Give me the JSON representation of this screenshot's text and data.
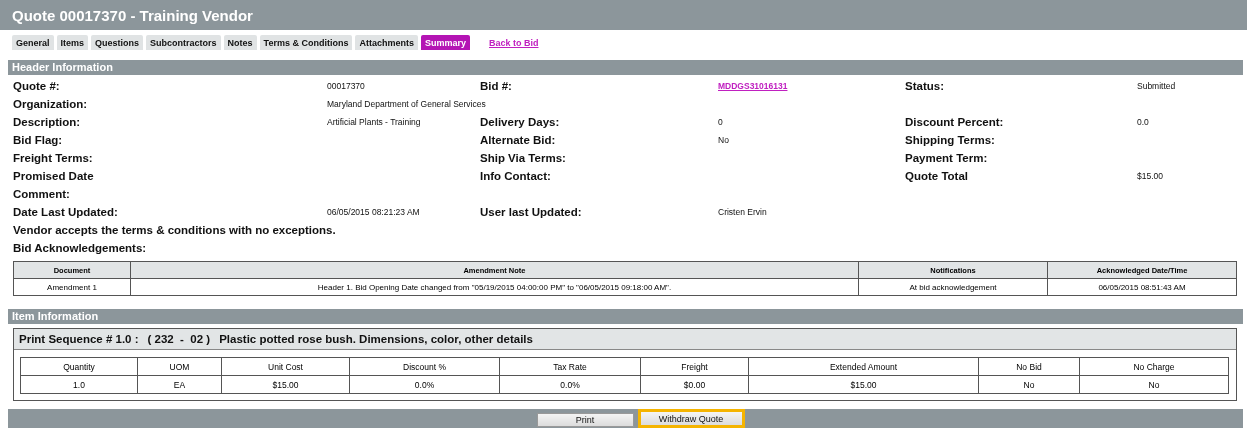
{
  "window": {
    "title": "Quote 00017370 - Training Vendor"
  },
  "tabs": [
    {
      "label": "General",
      "selected": false
    },
    {
      "label": "Items",
      "selected": false
    },
    {
      "label": "Questions",
      "selected": false
    },
    {
      "label": "Subcontractors",
      "selected": false
    },
    {
      "label": "Notes",
      "selected": false
    },
    {
      "label": "Terms & Conditions",
      "selected": false
    },
    {
      "label": "Attachments",
      "selected": false
    },
    {
      "label": "Summary",
      "selected": true
    }
  ],
  "back_link": "Back to Bid",
  "header_information": {
    "title": "Header Information",
    "rows": [
      {
        "kind": "fields",
        "fields": [
          {
            "kind": "text",
            "label": "Quote #:",
            "value": "00017370"
          },
          {
            "kind": "link",
            "label": "Bid #:",
            "value": "MDDGS31016131"
          },
          {
            "kind": "text",
            "label": "Status:",
            "value": "Submitted"
          }
        ]
      },
      {
        "kind": "fields",
        "fields": [
          {
            "kind": "text",
            "label": "Organization:",
            "value": "Maryland Department of General Services"
          }
        ]
      },
      {
        "kind": "fields",
        "fields": [
          {
            "kind": "text",
            "label": "Description:",
            "value": "Artificial Plants - Training"
          },
          {
            "kind": "text",
            "label": "Delivery Days:",
            "value": "0"
          },
          {
            "kind": "text",
            "label": "Discount Percent:",
            "value": "0.0"
          }
        ]
      },
      {
        "kind": "fields",
        "fields": [
          {
            "kind": "empty",
            "label": "Bid Flag:"
          },
          {
            "kind": "text",
            "label": "Alternate Bid:",
            "value": "No"
          },
          {
            "kind": "empty",
            "label": "Shipping Terms:"
          }
        ]
      },
      {
        "kind": "fields",
        "fields": [
          {
            "kind": "empty",
            "label": "Freight Terms:"
          },
          {
            "kind": "empty",
            "label": "Ship Via Terms:"
          },
          {
            "kind": "empty",
            "label": "Payment Term:"
          }
        ]
      },
      {
        "kind": "fields",
        "fields": [
          {
            "kind": "empty",
            "label": "Promised Date"
          },
          {
            "kind": "empty",
            "label": "Info Contact:"
          },
          {
            "kind": "text",
            "label": "Quote Total",
            "value": "$15.00"
          }
        ]
      },
      {
        "kind": "fields",
        "fields": [
          {
            "kind": "empty",
            "label": "Comment:"
          }
        ]
      },
      {
        "kind": "fields",
        "fields": [
          {
            "kind": "text",
            "label": "Date Last Updated:",
            "value": "06/05/2015 08:21:23 AM"
          },
          {
            "kind": "text",
            "label": "User last Updated:",
            "value": "Cristen Ervin"
          }
        ]
      },
      {
        "kind": "statement",
        "text": "Vendor accepts the terms & conditions with no exceptions."
      },
      {
        "kind": "statement",
        "text": "Bid Acknowledgements:"
      }
    ],
    "acknowledgements": {
      "columns": [
        "Document",
        "Amendment Note",
        "Notifications",
        "Acknowledged Date/Time"
      ],
      "rows": [
        [
          "Amendment 1",
          "Header 1. Bid Opening Date changed from \"05/19/2015 04:00:00 PM\" to \"06/05/2015 09:18:00 AM\".",
          "At bid acknowledgement",
          "06/05/2015 08:51:43 AM"
        ]
      ]
    }
  },
  "item_information": {
    "title": "Item Information",
    "items": [
      {
        "label": "Print Sequence # 1.0 :",
        "code": "( 232  -  02 )",
        "description": "Plastic potted rose bush. Dimensions, color, other details",
        "columns": [
          "Quantity",
          "UOM",
          "Unit Cost",
          "Discount %",
          "Tax Rate",
          "Freight",
          "Extended Amount",
          "No Bid",
          "No Charge"
        ],
        "rows": [
          [
            "1.0",
            "EA",
            "$15.00",
            "0.0%",
            "0.0%",
            "$0.00",
            "$15.00",
            "No",
            "No"
          ]
        ]
      }
    ]
  },
  "buttons": [
    {
      "label": "Print",
      "highlighted": false
    },
    {
      "label": "Withdraw Quote",
      "highlighted": true
    }
  ]
}
